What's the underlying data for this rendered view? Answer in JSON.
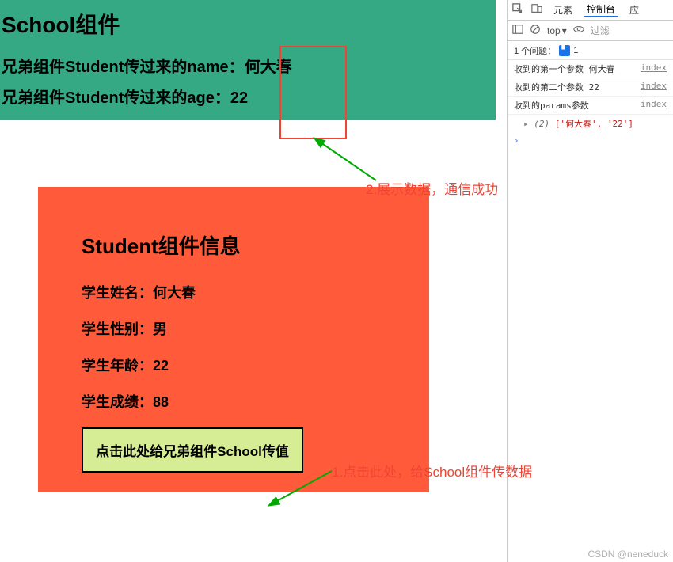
{
  "school": {
    "title": "School组件",
    "line1_label": "兄弟组件Student传过来的name：",
    "line1_value": "何大春",
    "line2_label": "兄弟组件Student传过来的age：",
    "line2_value": "22"
  },
  "student": {
    "title": "Student组件信息",
    "name_label": "学生姓名：",
    "name_value": "何大春",
    "gender_label": "学生性别：",
    "gender_value": "男",
    "age_label": "学生年龄：",
    "age_value": "22",
    "score_label": "学生成绩：",
    "score_value": "88",
    "button_label": "点击此处给兄弟组件School传值"
  },
  "annotations": {
    "step1": "1.点击此处，给School组件传数据",
    "step2": "2.展示数据，通信成功"
  },
  "devtools": {
    "tabs": {
      "elements": "元素",
      "console": "控制台",
      "more": "应"
    },
    "toolbar2": {
      "context": "top",
      "filter": "过滤"
    },
    "issues": {
      "label": "1 个问题：",
      "count": "1"
    },
    "console": {
      "line1_text": "收到的第一个参数",
      "line1_val": "何大春",
      "line1_src": "index",
      "line2_text": "收到的第二个参数",
      "line2_val": "22",
      "line2_src": "index",
      "line3_text": "收到的params参数",
      "line3_src": "index",
      "arr_len": "(2)",
      "arr_vals": "['何大春', '22']"
    }
  },
  "watermark": "CSDN @neneduck"
}
